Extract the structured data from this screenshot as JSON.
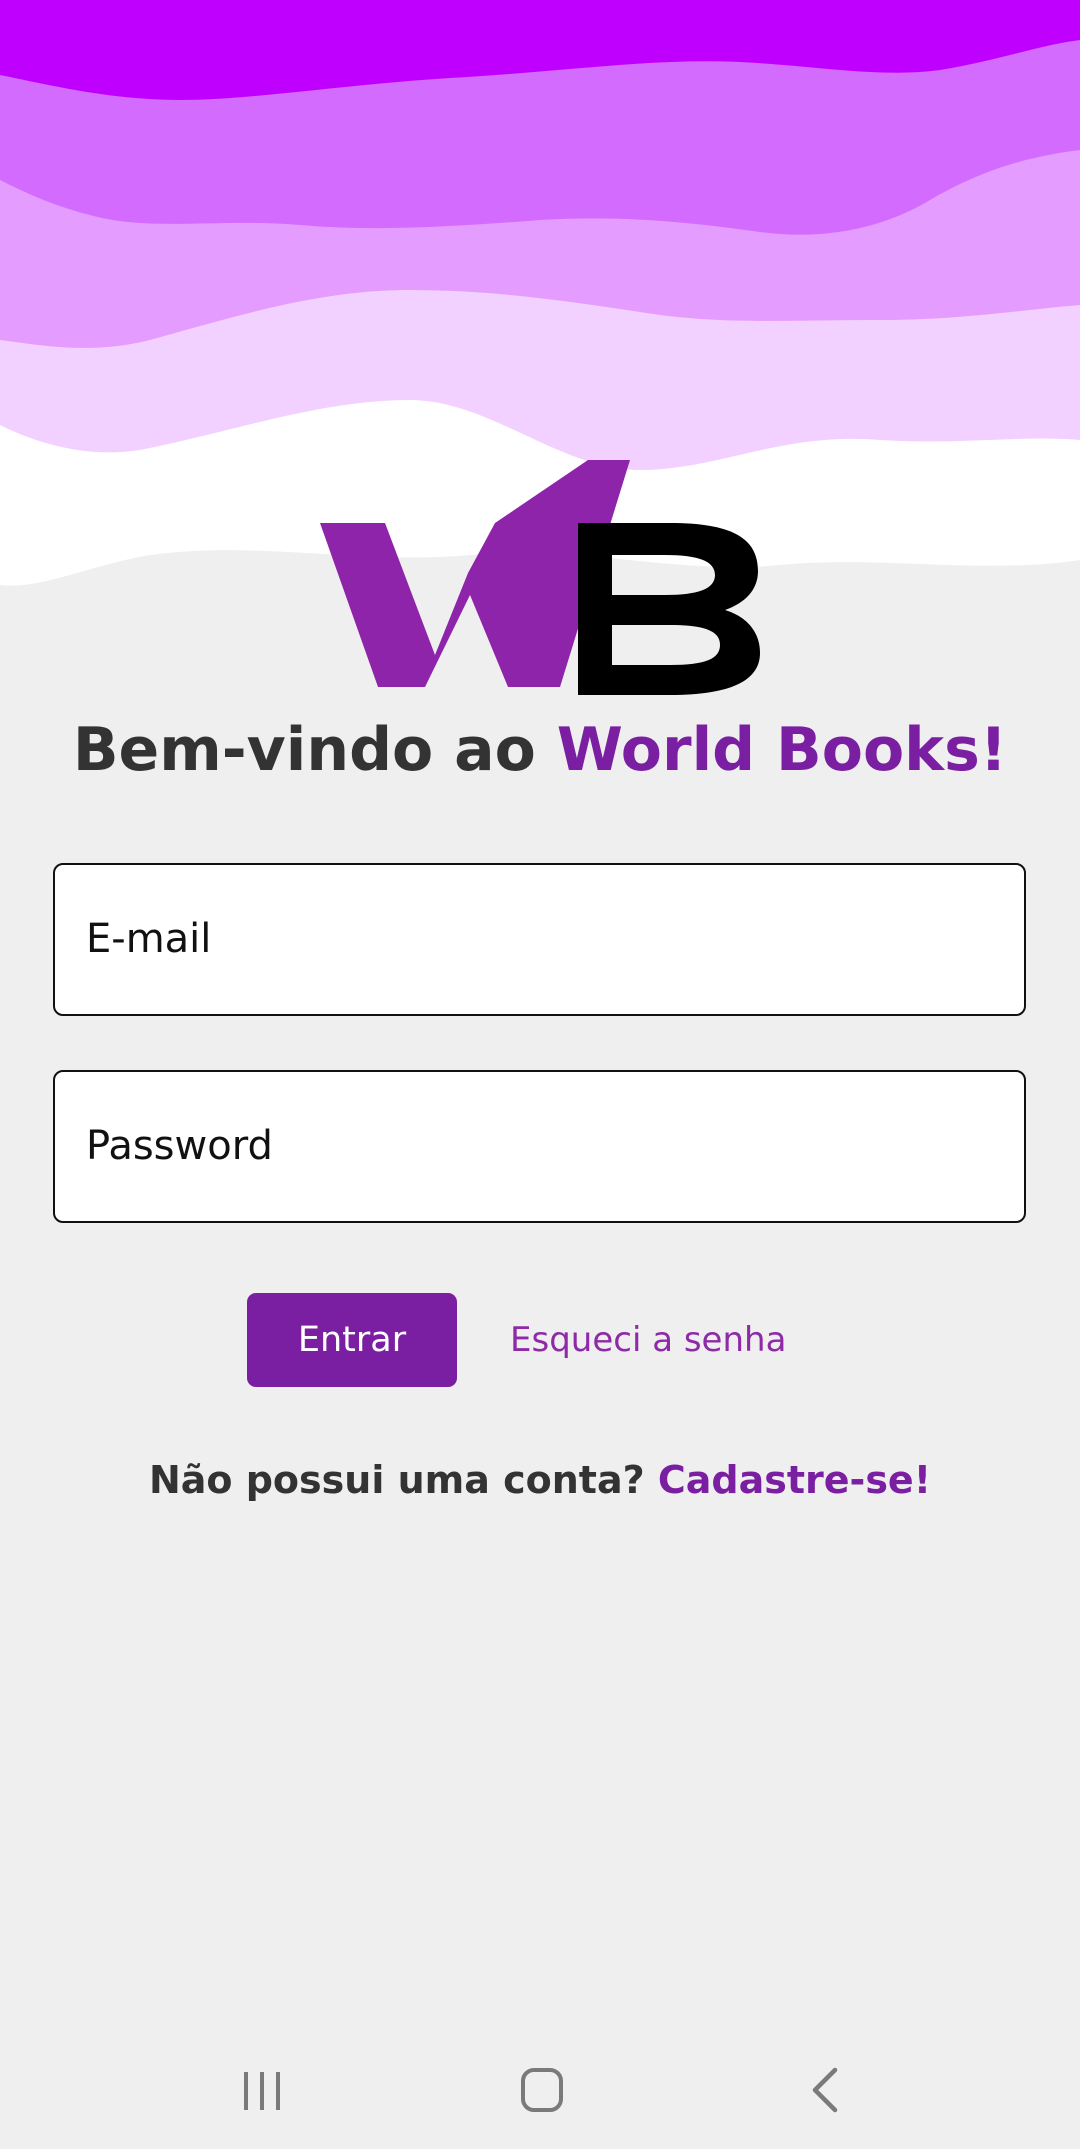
{
  "logo": {
    "letter_w": "W",
    "letter_b": "B",
    "colors": {
      "w": "#8e24aa",
      "b": "#000000"
    }
  },
  "welcome": {
    "prefix": "Bem-vindo ao ",
    "brand": "World Books!"
  },
  "email_field": {
    "placeholder": "E-mail"
  },
  "password_field": {
    "placeholder": "Password"
  },
  "actions": {
    "enter_label": "Entrar",
    "forgot_label": "Esqueci  a senha"
  },
  "signup": {
    "question": "Não possui uma conta? ",
    "link": "Cadastre-se!"
  },
  "navbar": {
    "icons": [
      "recents-icon",
      "home-icon",
      "back-icon"
    ]
  },
  "colors": {
    "accent": "#7b1fa2",
    "background": "#f0eff0",
    "wave_1": "#c000ff",
    "wave_2": "#d36bff",
    "wave_3": "#e49cff",
    "wave_4": "#f2d0ff"
  }
}
